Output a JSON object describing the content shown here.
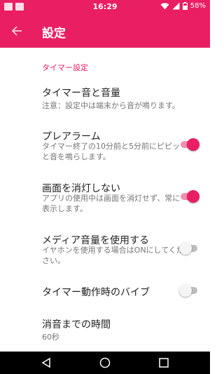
{
  "status_bar": {
    "time": "16:29",
    "battery": "58%",
    "icons": [
      "notification-icon",
      "image-icon",
      "wifi-icon",
      "signal-icon",
      "battery-icon"
    ]
  },
  "app_bar": {
    "title": "設定",
    "back_icon": "arrow-back-icon",
    "color": "#e91e63"
  },
  "section": {
    "header": "タイマー設定"
  },
  "preferences": [
    {
      "title": "タイマー音と音量",
      "summary": "注意：設定中は端末から音が鳴ります。"
    },
    {
      "title": "プレアラーム",
      "summary": "タイマー終了の10分前と5分前にピピッと音を鳴らします。",
      "switch": "on"
    },
    {
      "title": "画面を消灯しない",
      "summary": "アプリの使用中は画面を消灯せず、常に表示します。",
      "switch": "on"
    },
    {
      "title": "メディア音量を使用する",
      "summary": "イヤホンを使用する場合はONにしてください。",
      "switch": "off"
    },
    {
      "title": "タイマー動作時のバイブ",
      "switch": "off"
    },
    {
      "title": "消音までの時間",
      "summary": "60秒"
    }
  ],
  "nav_bar": {
    "icons": [
      "back-triangle-icon",
      "home-circle-icon",
      "recents-square-icon"
    ]
  }
}
